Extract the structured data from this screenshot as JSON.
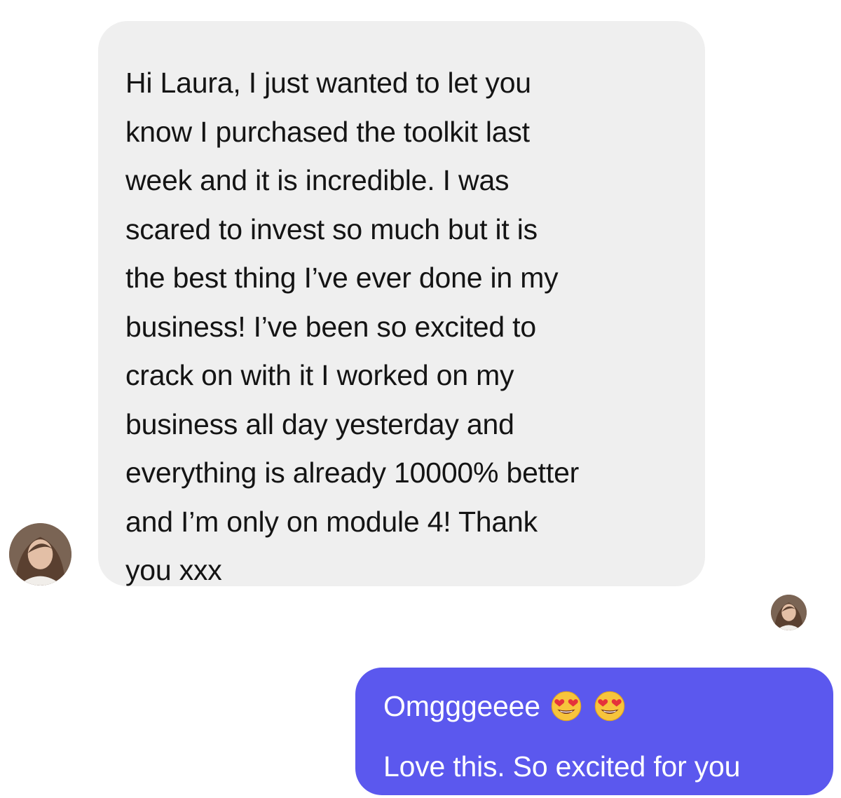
{
  "thread": {
    "incoming": {
      "text": "Hi Laura, I just wanted to let you\nknow I purchased the toolkit last\nweek and it is incredible. I was\nscared to invest so much but it is\nthe best thing I’ve ever done in my\nbusiness! I’ve been so excited to\ncrack on with it I worked on my\nbusiness all day yesterday and\neverything is already 10000% better\nand I’m only on module 4! Thank\nyou xxx",
      "avatar_icon": "sender-avatar-photo"
    },
    "seen_indicator": {
      "avatar_icon": "seen-avatar-photo"
    },
    "outgoing": {
      "line1": "Omgggeeee",
      "emojis": [
        "heart-eyes-emoji",
        "heart-eyes-emoji"
      ],
      "line2": "Love this. So excited for you"
    }
  },
  "colors": {
    "incoming_bubble": "#efefef",
    "outgoing_bubble": "#5b58ee",
    "incoming_text": "#141414",
    "outgoing_text": "#ffffff"
  }
}
